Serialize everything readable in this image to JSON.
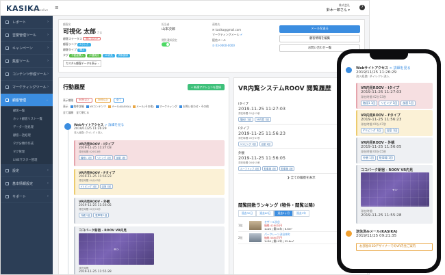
{
  "app": {
    "logo": "KASIKA",
    "logo_sub": "by Cocolive",
    "menu_icon": "≡",
    "user_company": "株式会社",
    "user_name": "鈴木一郎さん ▾",
    "help": "?"
  },
  "sidebar": {
    "items": [
      {
        "label": "レポート",
        "icon": "report-icon"
      },
      {
        "label": "営業管理ツール",
        "icon": "sales-icon"
      },
      {
        "label": "キャンペーン",
        "icon": "campaign-icon"
      },
      {
        "label": "集客ツール",
        "icon": "attract-icon"
      },
      {
        "label": "コンテンツ作成ツール",
        "icon": "content-icon"
      },
      {
        "label": "マーケティングツール",
        "icon": "marketing-icon"
      },
      {
        "label": "顧客管理",
        "icon": "customer-icon",
        "active": true
      }
    ],
    "subitems": [
      "顧客一覧",
      "ホット顧客リスト一覧",
      "データ一括処理",
      "顧客一括処理",
      "タグ分類の作成",
      "タグ管理",
      "LINEマスター管理"
    ],
    "bottom_items": [
      {
        "label": "設定",
        "icon": "settings-icon"
      },
      {
        "label": "基本情報設定",
        "icon": "info-icon"
      },
      {
        "label": "サポート",
        "icon": "support-icon"
      }
    ]
  },
  "profile": {
    "name_label": "顧客名",
    "name": "可視化 太郎",
    "honorific": "さま",
    "stage_label": "顧客ステータス",
    "stage_value": "問い合わせ",
    "rank_label": "顧客ランク",
    "rank_value": "Aランク",
    "type_label": "顧客タイプ",
    "type_value": "購入",
    "tags_label": "タグ",
    "tags": [
      "不動産購入",
      "戸建検討",
      "VR内見",
      "資料請求"
    ],
    "memo_button": "カスタム顧客データを表示 ›",
    "owner_label": "担当者",
    "owner_value": "山本次郎",
    "notify_label": "閲覧通知設定",
    "contact_label": "連絡先",
    "email": "kasika@gmail.com",
    "opt_label": "マーケティングメール",
    "consent_label": "配信メール",
    "phone": "03-0000-0000",
    "btn_mail": "メールを送る",
    "btn_edit": "顧客情報を編集",
    "btn_note": "お問い合わせ一覧"
  },
  "history": {
    "title": "行動履歴",
    "add_button": "+ 新規アクションを登録",
    "filter_label": "表示期間",
    "chips": [
      "60分以上",
      "30分以上",
      "全て"
    ],
    "display_label": "表示",
    "checks": [
      "物件詳細",
      "VRコンテンツ",
      "メール(KASIKA)",
      "メール(その他)",
      "マーケティング",
      "お問い合わせ・その他"
    ],
    "collapse_all": "全て展開",
    "expand_all": "全て閉じる",
    "events": [
      {
        "title": "Webサイトアクセス",
        "link": "> 詳細を見る",
        "time": "2019/11/25 11:26:29",
        "meta": "流入経路: ダイレクト流入"
      },
      {
        "title": "VR内見ROOV - Iタイプ",
        "time": "2019-11-25 11:27:03",
        "meta": "滞在時間",
        "dur": "02分13秒",
        "tags": [
          "階段1 1回",
          "リビング 1回",
          "部屋 1回"
        ]
      },
      {
        "title": "VR内見ROOV - Fタイプ",
        "time": "2019-11-25 11:56:23",
        "meta": "滞在時間",
        "dur": "00分47秒",
        "tags": [
          "Vリビング 1回",
          "浴室 1回"
        ]
      },
      {
        "title": "VR内見ROOV - 外観",
        "time": "2019-11-25 11:56:05",
        "meta": "滞在時間",
        "dur": "00分15秒",
        "tags": [
          "外観 1回",
          "駐車場 1回"
        ]
      },
      {
        "title": "ココバーク新宿 - ROOV VR内見",
        "time": "2019-11-25 11:55:28",
        "meta": "滞在時間"
      }
    ]
  },
  "vr_panel": {
    "title": "VR内覧システムROOV 閲覧履歴",
    "items": [
      {
        "name": "Iタイプ",
        "dt": "2019-11-25 11:27:03",
        "meta": "滞在時間",
        "dur": "02分13秒",
        "tags": [
          "階段1 1回",
          "VR内見 1回"
        ]
      },
      {
        "name": "Fタイプ",
        "dt": "2019-11-25 11:56:23",
        "meta": "滞在時間",
        "dur": "00分47秒",
        "tags": [
          "Vリビング 1回",
          "浴室 1回"
        ]
      },
      {
        "name": "外観",
        "dt": "2019-11-25 11:56:05",
        "meta": "滞在時間",
        "dur": "00分15秒",
        "tags": [
          "ルーフトップ 1回",
          "駐車場 1回",
          "駐車場 1回"
        ]
      }
    ],
    "more": "❯ 全ての履歴を表示",
    "ranking_title": "閲覧回数ランキング (物件・閲覧以降)",
    "ranking_tabs": [
      "過去30日",
      "過去60日",
      "過去3ヶ月",
      "過去1年"
    ],
    "ranking": [
      {
        "rank": "1位",
        "name": "セザール渋谷",
        "price": "価格 4280万円",
        "info": "1LDK | 築30年 | 6.6m²",
        "addr": "渋谷区渋谷 - 渋谷駅"
      },
      {
        "rank": "2位",
        "name": "パークレーン渋谷本町",
        "price": "価格 5890万円",
        "info": "1LDK | 築10年 | 55.6m²",
        "addr": "渋谷区本町 - 初台駅"
      }
    ]
  },
  "phone": {
    "events": [
      {
        "title": "Webサイトアクセス",
        "link": "> 詳細を見る",
        "time": "2019/11/25 11:26:29",
        "meta": "流入経路: ダイレクト流入"
      },
      {
        "title": "VR内見ROOV - Iタイプ",
        "time": "2019-11-25 11:27:03",
        "meta": "滞在時間",
        "dur": "02分13秒",
        "tags": [
          "階段1 1回",
          "リビング 1回",
          "部屋 1回"
        ]
      },
      {
        "title": "VR内見ROOV - Fタイプ",
        "time": "2019-11-25 11:56:23",
        "meta": "滞在時間",
        "dur": "00分47秒",
        "tags": [
          "Vリビング 1回",
          "浴室 1回"
        ]
      },
      {
        "title": "VR内見ROOV - 外観",
        "time": "2019-11-25 11:56:05",
        "meta": "滞在時間",
        "dur": "00分15秒",
        "tags": [
          "外観 1回",
          "駐車場 1回"
        ]
      },
      {
        "title": "ココバーク新宿 - ROOV VR内見",
        "time": "2019-11-25 11:55:28",
        "meta": "滞在時間"
      }
    ],
    "mail_title": "送信済みメール(KASIKA)",
    "mail_time": "2019/11/25 09:21:35",
    "mail_button": "お部屋の3DデザイナーでのVR内見ご案内"
  },
  "colors": {
    "accent": "#3b8de0",
    "sidebar": "#2c3e56",
    "green": "#3ec07a"
  }
}
